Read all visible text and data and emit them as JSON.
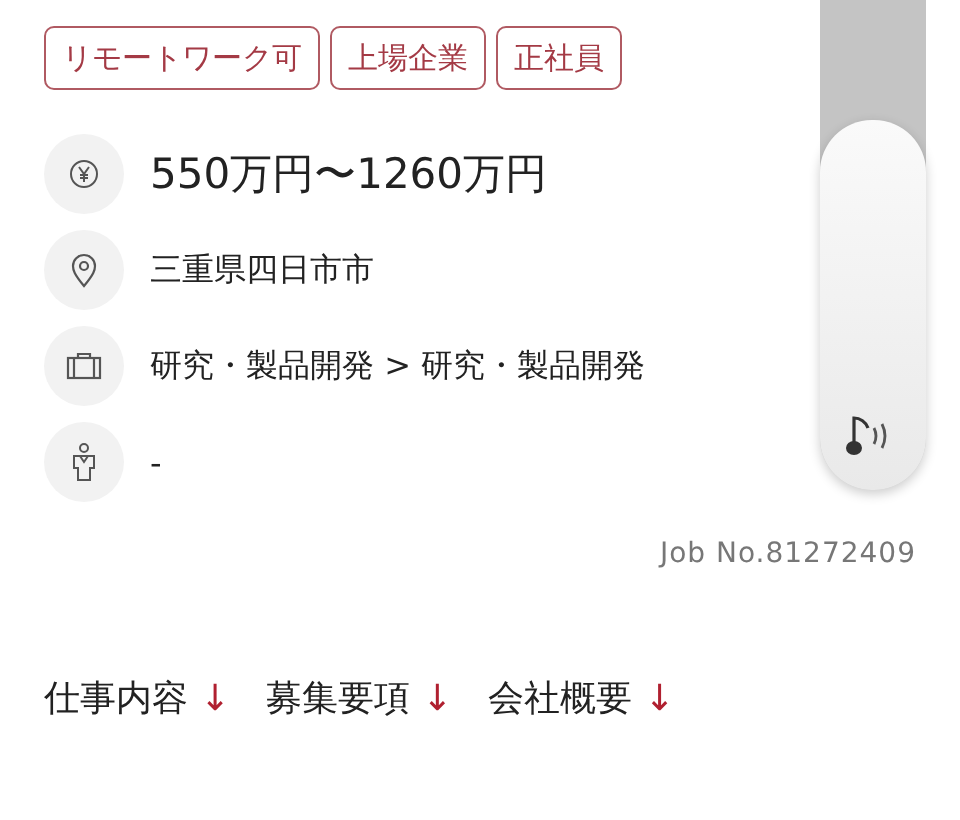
{
  "tags": [
    "リモートワーク可",
    "上場企業",
    "正社員"
  ],
  "details": [
    {
      "kind": "salary",
      "text": "550万円〜1260万円"
    },
    {
      "kind": "location",
      "text": "三重県四日市市"
    },
    {
      "kind": "category",
      "text": "研究・製品開発 > 研究・製品開発"
    },
    {
      "kind": "person",
      "text": "-"
    }
  ],
  "job_number": "Job No.81272409",
  "anchors": [
    {
      "label": "仕事内容",
      "arrow": "↓"
    },
    {
      "label": "募集要項",
      "arrow": "↓"
    },
    {
      "label": "会社概要",
      "arrow": "↓"
    }
  ]
}
